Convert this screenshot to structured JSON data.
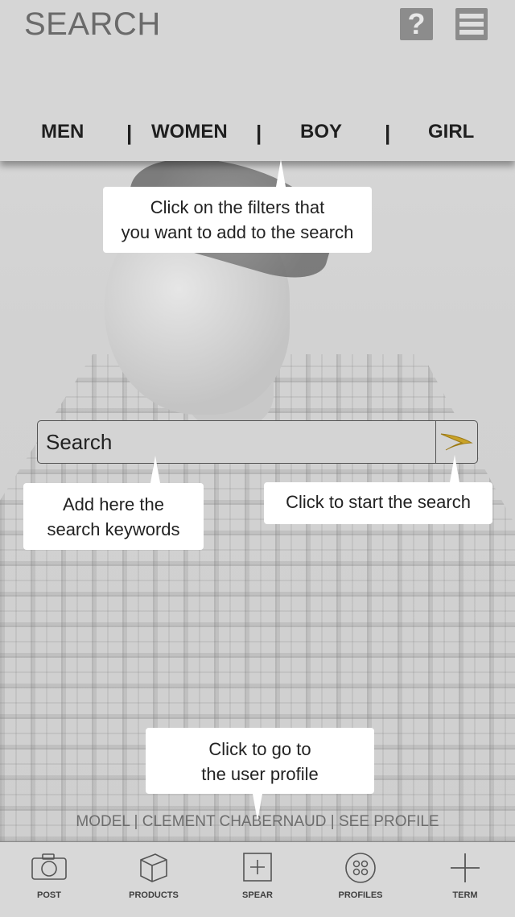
{
  "header": {
    "title": "SEARCH",
    "help_label": "?",
    "tabs": [
      "MEN",
      "WOMEN",
      "BOY",
      "GIRL"
    ],
    "separator": "|"
  },
  "tooltips": {
    "filters": "Click on the filters that you want to add to the search",
    "filters_line1": "Click on the filters that",
    "filters_line2": "you want to add to the search",
    "keywords_line1": "Add here the",
    "keywords_line2": "search keywords",
    "start": "Click to start the search",
    "profile_line1": "Click to go to",
    "profile_line2": "the user profile"
  },
  "search": {
    "value": "Search",
    "go_icon": "arrow-right-icon",
    "accent": "#c9a227"
  },
  "credit": {
    "text": "MODEL | CLEMENT CHABERNAUD | SEE PROFILE"
  },
  "nav": {
    "items": [
      {
        "label": "POST",
        "icon": "camera-icon"
      },
      {
        "label": "PRODUCTS",
        "icon": "box-icon"
      },
      {
        "label": "SPEAR",
        "icon": "plus-square-icon"
      },
      {
        "label": "PROFILES",
        "icon": "circles-icon"
      },
      {
        "label": "TERM",
        "icon": "plus-icon"
      }
    ]
  }
}
